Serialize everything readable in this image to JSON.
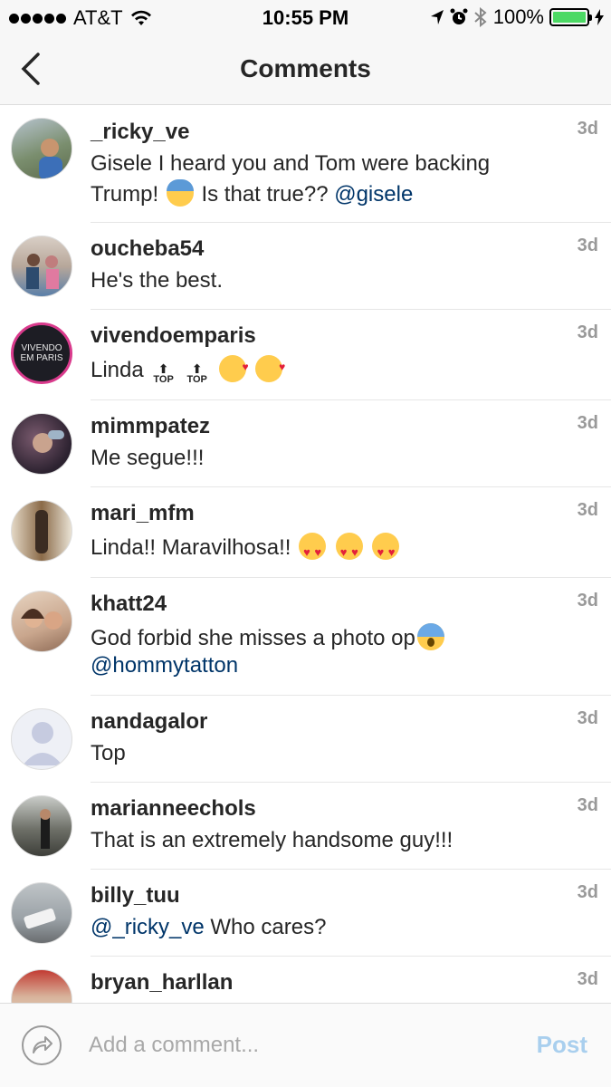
{
  "status_bar": {
    "carrier": "AT&T",
    "time": "10:55 PM",
    "battery": "100%",
    "battery_level": 1.0,
    "icons": [
      "signal-dots",
      "wifi-icon",
      "location-arrow-icon",
      "alarm-icon",
      "bluetooth-icon",
      "battery-icon",
      "charging-bolt-icon"
    ]
  },
  "nav": {
    "title": "Comments",
    "back_icon": "chevron-left-icon"
  },
  "comments": [
    {
      "username": "_ricky_ve",
      "time": "3d",
      "avatar_color": "#7a8e6e",
      "text1": "Gisele I heard you and Tom were backing",
      "text2": "Trump! ",
      "text3": " Is that true?? ",
      "mention": "@gisele"
    },
    {
      "username": "oucheba54",
      "time": "3d",
      "avatar_color": "#b7a79a",
      "text": "He's the best."
    },
    {
      "username": "vivendoemparis",
      "time": "3d",
      "avatar_color": "#1d1d24",
      "avatar_text1": "VIVENDO",
      "avatar_text2": "EM PARIS",
      "text": "Linda ",
      "top_label": "TOP"
    },
    {
      "username": "mimmpatez",
      "time": "3d",
      "avatar_color": "#2c2230",
      "text": "Me segue!!!"
    },
    {
      "username": "mari_mfm",
      "time": "3d",
      "avatar_color": "#8a6a48",
      "text": "Linda!! Maravilhosa!! "
    },
    {
      "username": "khatt24",
      "time": "3d",
      "avatar_color": "#c9a68d",
      "text": "God forbid she misses a photo op",
      "mention": "@hommytatton"
    },
    {
      "username": "nandagalor",
      "time": "3d",
      "avatar_color": "#dfe3ee",
      "text": "Top"
    },
    {
      "username": "marianneechols",
      "time": "3d",
      "avatar_color": "#6e7068",
      "text": "That is an extremely handsome guy!!!"
    },
    {
      "username": "billy_tuu",
      "time": "3d",
      "avatar_color": "#9aa1a6",
      "mention": "@_ricky_ve",
      "text": " Who cares?"
    },
    {
      "username": "bryan_harllan",
      "time": "3d",
      "avatar_color": "#a0413a"
    }
  ],
  "composer": {
    "placeholder": "Add a comment...",
    "post_label": "Post",
    "share_icon": "share-arrow-icon"
  },
  "colors": {
    "mention": "#003569",
    "post_disabled": "#a9cfee",
    "battery": "#4cd964"
  }
}
